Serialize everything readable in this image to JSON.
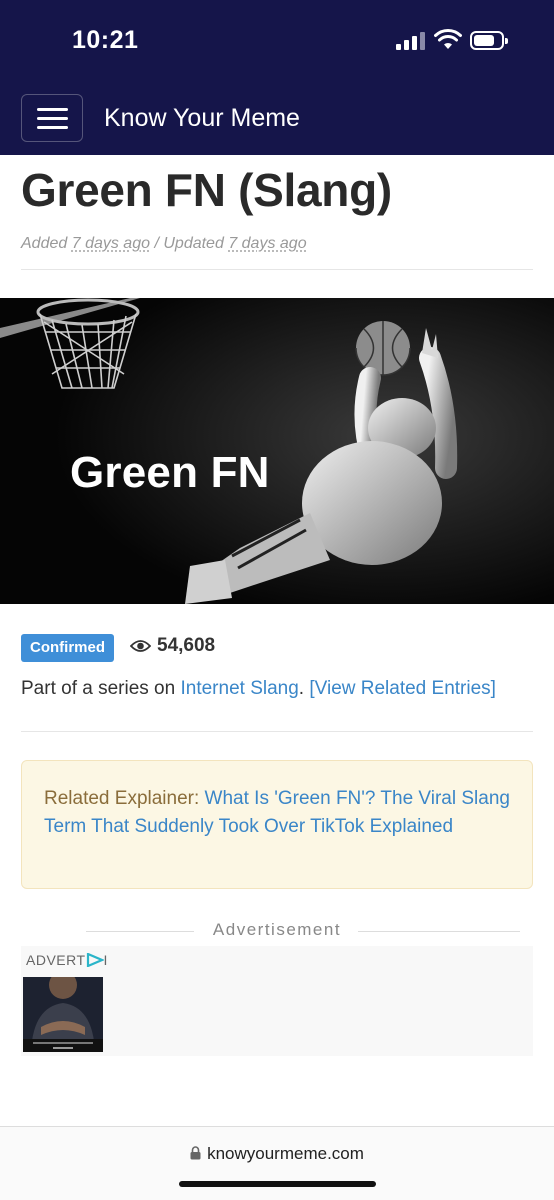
{
  "status_bar": {
    "time": "10:21",
    "battery_level": 0.75
  },
  "header": {
    "site_name": "Know Your Meme",
    "menu_icon": "hamburger-menu-icon"
  },
  "entry": {
    "title": "Green FN (Slang)",
    "added_label": "Added",
    "added_time": "7 days ago",
    "divider": "/",
    "updated_label": "Updated",
    "updated_time": "7 days ago",
    "hero_text": "Green FN",
    "badge": "Confirmed",
    "views": "54,608",
    "series_prefix": "Part of a series on",
    "series_link": "Internet Slang",
    "series_period": ".",
    "related_entries": "[View Related Entries]"
  },
  "explainer": {
    "label": "Related Explainer:",
    "link": "What Is 'Green FN'? The Viral Slang Term That Suddenly Took Over TikTok Explained"
  },
  "ad": {
    "label": "Advertisement",
    "tag": "ADVERT",
    "tag_end": "I"
  },
  "browser": {
    "url": "knowyourmeme.com"
  },
  "colors": {
    "header_bg": "#15154a",
    "link": "#3a86c8",
    "badge": "#3f8fd8",
    "explainer_bg": "#fcf7e4"
  }
}
